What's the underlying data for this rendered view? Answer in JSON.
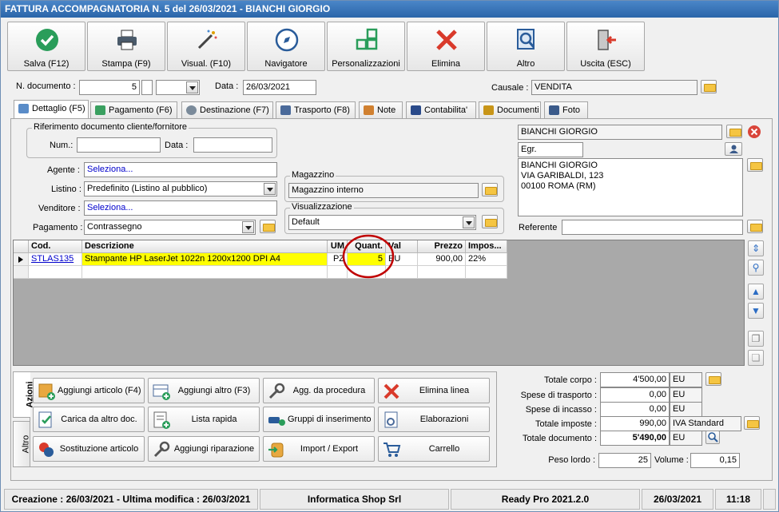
{
  "window": {
    "title": "FATTURA ACCOMPAGNATORIA N. 5 del 26/03/2021 - BIANCHI GIORGIO"
  },
  "toolbar": [
    {
      "label": "Salva (F12)",
      "icon": "check-icon"
    },
    {
      "label": "Stampa (F9)",
      "icon": "printer-icon"
    },
    {
      "label": "Visual. (F10)",
      "icon": "magic-wand-icon"
    },
    {
      "label": "Navigatore",
      "icon": "compass-icon"
    },
    {
      "label": "Personalizzazioni",
      "icon": "grid-icon"
    },
    {
      "label": "Elimina",
      "icon": "delete-x-icon"
    },
    {
      "label": "Altro",
      "icon": "magnifier-icon"
    },
    {
      "label": "Uscita (ESC)",
      "icon": "exit-door-icon"
    }
  ],
  "header": {
    "ndoc_label": "N. documento :",
    "ndoc_value": "5",
    "data_label": "Data :",
    "data_value": "26/03/2021",
    "causale_label": "Causale :",
    "causale_value": "VENDITA"
  },
  "tabs": [
    {
      "label": "Dettaglio (F5)",
      "active": true
    },
    {
      "label": "Pagamento (F6)"
    },
    {
      "label": "Destinazione (F7)"
    },
    {
      "label": "Trasporto (F8)"
    },
    {
      "label": "Note"
    },
    {
      "label": "Contabilita'"
    },
    {
      "label": "Documenti"
    },
    {
      "label": "Foto"
    }
  ],
  "detail": {
    "rif_title": "Riferimento documento cliente/fornitore",
    "num_label": "Num.:",
    "data_label": "Data :",
    "agente_label": "Agente :",
    "agente_value": "Seleziona...",
    "listino_label": "Listino :",
    "listino_value": "Predefinito (Listino al pubblico)",
    "venditore_label": "Venditore :",
    "venditore_value": "Seleziona...",
    "pagamento_label": "Pagamento :",
    "pagamento_value": "Contrassegno",
    "magazzino_title": "Magazzino",
    "magazzino_value": "Magazzino interno",
    "visual_title": "Visualizzazione",
    "visual_value": "Default"
  },
  "customer": {
    "name": "BIANCHI GIORGIO",
    "title": "Egr.",
    "address_lines": [
      "BIANCHI GIORGIO",
      "VIA GARIBALDI, 123",
      "00100 ROMA (RM)"
    ],
    "referente_label": "Referente"
  },
  "grid": {
    "columns": [
      "Cod.",
      "Descrizione",
      "UM",
      "Quant.",
      "Val",
      "Prezzo",
      "Impos..."
    ],
    "rows": [
      {
        "cod": "STLAS135",
        "descrizione": "Stampante HP LaserJet 1022n 1200x1200 DPI A4",
        "um": "PZ",
        "quant": "5",
        "val": "EU",
        "prezzo": "900,00",
        "imposta": "22%"
      }
    ]
  },
  "side_tabs": [
    "Azioni",
    "Altro"
  ],
  "actions": [
    {
      "label": "Aggiungi articolo (F4)",
      "icon": "add-article-icon"
    },
    {
      "label": "Aggiungi altro (F3)",
      "icon": "add-other-icon"
    },
    {
      "label": "Agg. da procedura",
      "icon": "wrench-icon"
    },
    {
      "label": "Elimina linea",
      "icon": "delete-line-icon"
    },
    {
      "label": "Carica da altro doc.",
      "icon": "load-doc-icon"
    },
    {
      "label": "Lista rapida",
      "icon": "quick-list-icon"
    },
    {
      "label": "Gruppi di inserimento",
      "icon": "insert-group-icon"
    },
    {
      "label": "Elaborazioni",
      "icon": "processing-icon"
    },
    {
      "label": "Sostituzione articolo",
      "icon": "replace-article-icon"
    },
    {
      "label": "Aggiungi riparazione",
      "icon": "repair-icon"
    },
    {
      "label": "Import / Export",
      "icon": "import-export-icon"
    },
    {
      "label": "Carrello",
      "icon": "cart-icon"
    }
  ],
  "totals": {
    "totale_corpo_label": "Totale corpo :",
    "totale_corpo": "4'500,00",
    "totale_corpo_cur": "EU",
    "spese_trasporto_label": "Spese di trasporto :",
    "spese_trasporto": "0,00",
    "spese_trasporto_cur": "EU",
    "spese_incasso_label": "Spese di incasso :",
    "spese_incasso": "0,00",
    "spese_incasso_cur": "EU",
    "totale_imposte_label": "Totale imposte :",
    "totale_imposte": "990,00",
    "totale_imposte_desc": "IVA Standard",
    "totale_documento_label": "Totale documento :",
    "totale_documento": "5'490,00",
    "totale_documento_cur": "EU",
    "peso_label": "Peso lordo :",
    "peso": "25",
    "volume_label": "Volume :",
    "volume": "0,15"
  },
  "statusbar": {
    "dates": "Creazione : 26/03/2021 - Ultima modifica : 26/03/2021",
    "company": "Informatica Shop Srl",
    "product": "Ready Pro 2021.2.0",
    "date": "26/03/2021",
    "time": "11:18"
  },
  "colors": {
    "title": "#2b65a9",
    "highlight_row": "#ffff00",
    "annotation": "#c00000",
    "link": "#0000cc"
  }
}
